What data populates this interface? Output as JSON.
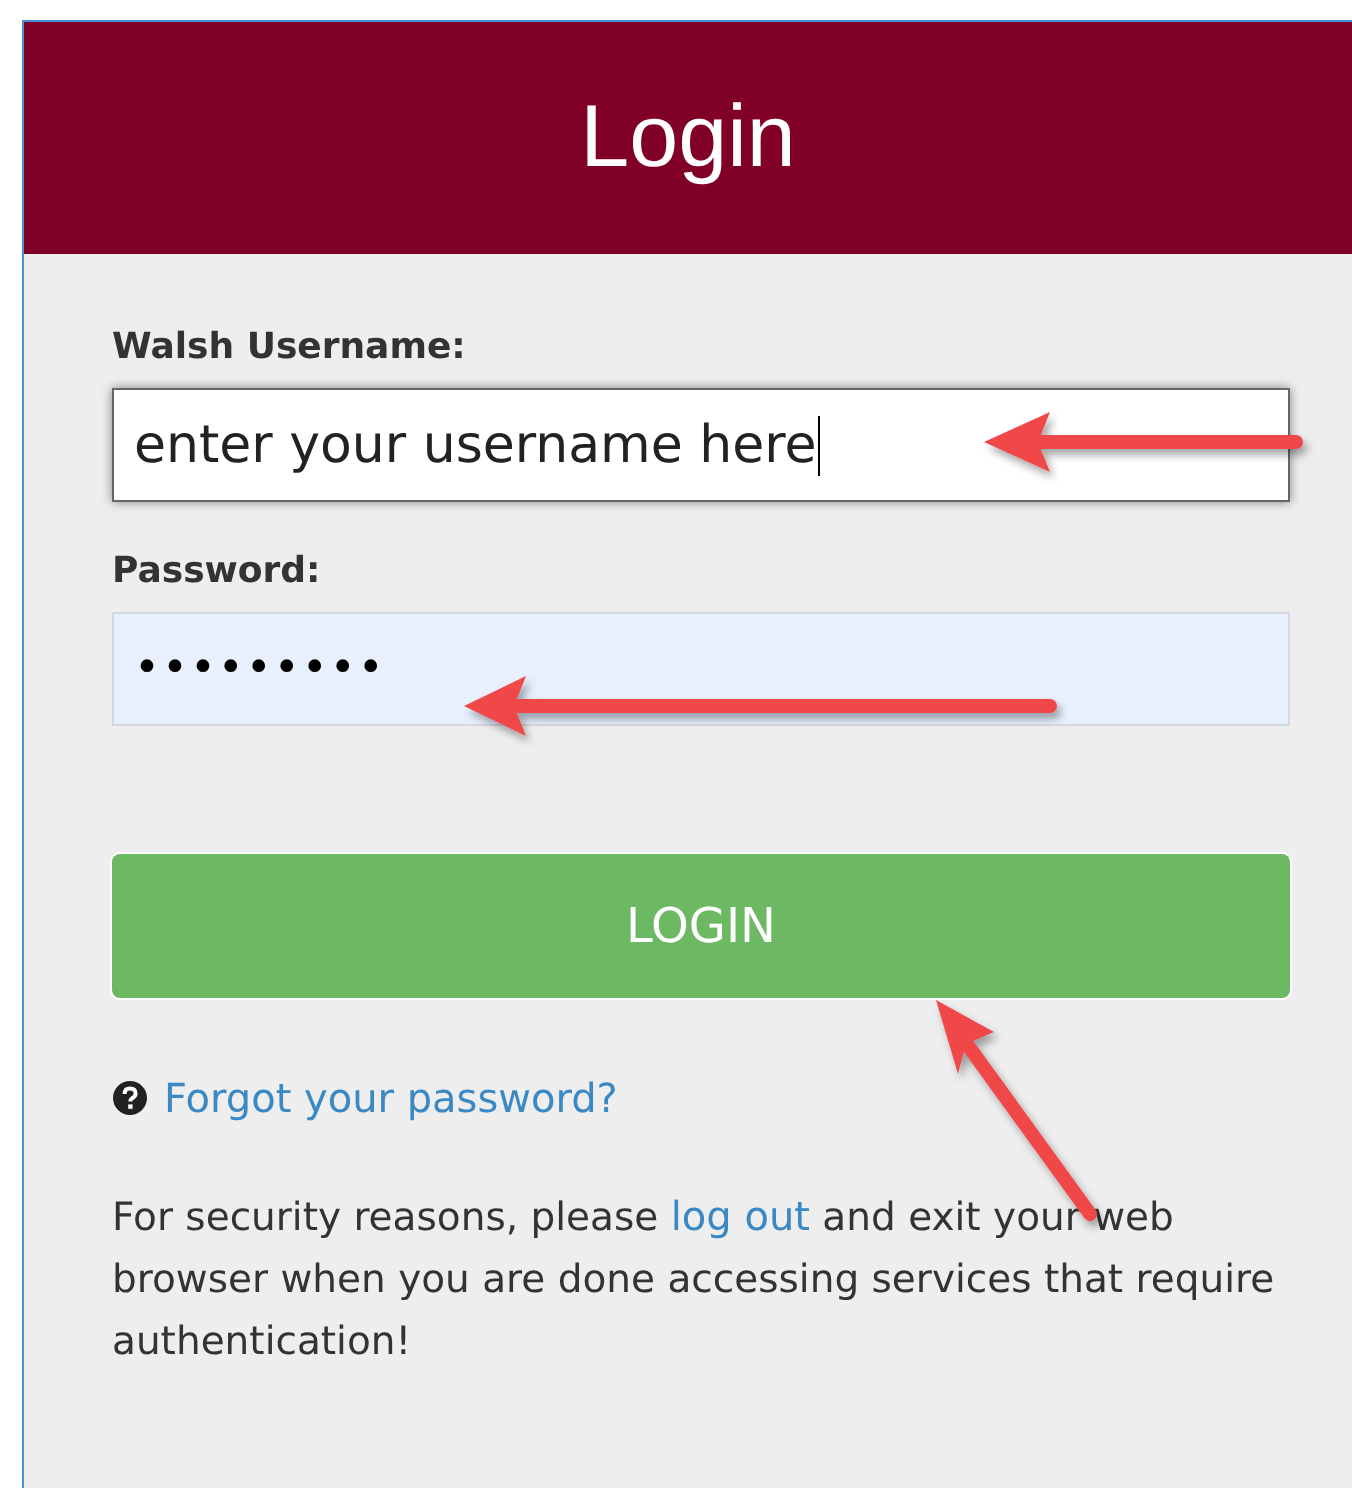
{
  "header": {
    "title": "Login"
  },
  "fields": [
    {
      "label": "Walsh Username:",
      "value": "enter your username here",
      "kind": "text",
      "focused": true
    },
    {
      "label": "Password:",
      "value": "•••••••••",
      "kind": "password",
      "focused": false
    }
  ],
  "login_button": {
    "label": "LOGIN"
  },
  "forgot_link": {
    "label": "Forgot your password?"
  },
  "notice": {
    "before": "For security reasons, please ",
    "link": "log out",
    "after": " and exit your web browser when you are done accessing services that require authentication!"
  }
}
